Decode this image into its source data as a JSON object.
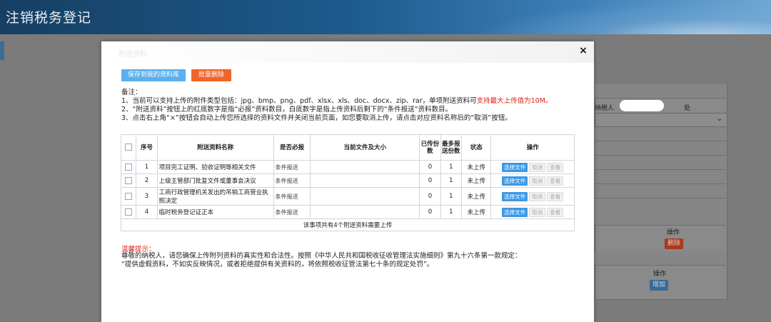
{
  "app": {
    "title": "注销税务登记"
  },
  "background": {
    "field_label_suffix": "处",
    "field_label_prefix": "纳税人",
    "col_op_1": "操作",
    "delete_btn": "删除",
    "col_op_2": "操作",
    "add_btn": "增加"
  },
  "modal": {
    "title_ghost": "附送资料",
    "close_label": "×",
    "save_button": "保存到我的资料库",
    "batch_delete_button": "批量删除",
    "notes": {
      "heading": "备注：",
      "line1_prefix": "1、当前可以支持上传的附件类型包括：jpg、bmp、png、pdf、xlsx、xls、doc、docx、zip、rar，单项附送资料可",
      "line1_red": "支持最大上传值为10M。",
      "line2": "2、“附送资料”按钮上的红底数字是指“必报”资料数目，白底数字是指上传资料后剩下的“条件报送”资料数目。",
      "line3": "3、点击右上角“×”按钮会自动上传您所选择的资料文件并关闭当前页面，如您要取消上传，请点击对应资料名称后的“取消”按钮。"
    },
    "table": {
      "headers": {
        "seq": "序号",
        "name": "附送资料名称",
        "required": "是否必报",
        "current_file": "当前文件及大小",
        "uploaded": "已传份数",
        "max": "最多报送份数",
        "status": "状态",
        "ops": "操作"
      },
      "rows": [
        {
          "seq": "1",
          "name": "项目完工证明、验收证明等相关文件",
          "required": "条件报送",
          "file": "",
          "uploaded": "0",
          "max": "1",
          "status": "未上传"
        },
        {
          "seq": "2",
          "name": "上级主管部门批复文件或董事会决议",
          "required": "条件报送",
          "file": "",
          "uploaded": "0",
          "max": "1",
          "status": "未上传"
        },
        {
          "seq": "3",
          "name": "工商行政管理机关发出的吊销工商营业执照决定",
          "required": "条件报送",
          "file": "",
          "uploaded": "0",
          "max": "1",
          "status": "未上传"
        },
        {
          "seq": "4",
          "name": "临时税务登记证正本",
          "required": "条件报送",
          "file": "",
          "uploaded": "0",
          "max": "1",
          "status": "未上传"
        }
      ],
      "op_labels": {
        "choose": "选择文件",
        "cancel": "取消",
        "view": "查看"
      },
      "footer": "该事项共有4个附送资料需要上传"
    },
    "tips": {
      "title": "温馨提示：",
      "line1": "尊敬的纳税人，请您确保上传附列资料的真实性和合法性。按照《中华人民共和国税收征收管理法实施细则》第九十六条第一款规定：",
      "line2": "“提供虚假资料，不如实反映情况，或者拒绝提供有关资料的，将依照税收征管法第七十条的规定处罚”。"
    }
  }
}
